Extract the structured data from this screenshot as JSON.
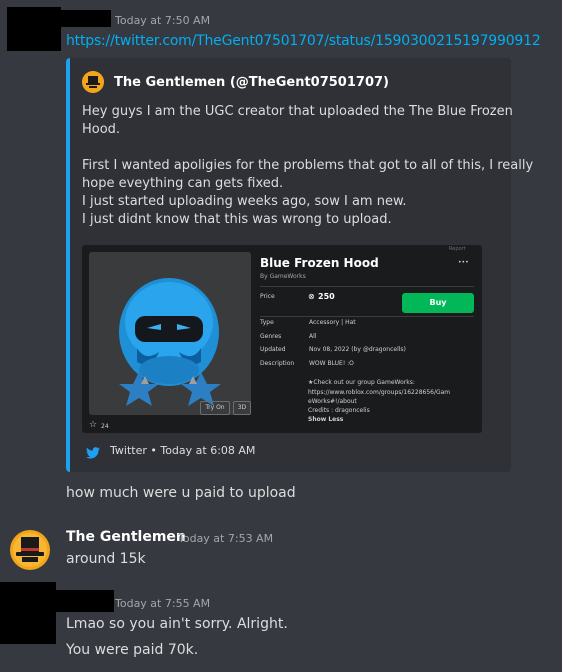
{
  "message1": {
    "timestamp": "Today at 7:50 AM",
    "link": "https://twitter.com/TheGent07501707/status/1590300215197990912"
  },
  "embed": {
    "author": "The Gentlemen (@TheGent07501707)",
    "lines": [
      "Hey guys I am the UGC creator that uploaded the The Blue Frozen",
      "Hood.",
      "",
      "First I wanted apoligies for the problems that got to all of this, I really",
      "hope eveything can gets fixed.",
      "I just started uploading weeks ago, sow I am new.",
      "I just didnt know that this was wrong to upload."
    ],
    "card": {
      "title": "Blue Frozen Hood",
      "by": "By GameWorks",
      "price_label": "Price",
      "price": "250",
      "buy_label": "Buy",
      "type_label": "Type",
      "type_value": "Accessory | Hat",
      "genres_label": "Genres",
      "genres_value": "All",
      "updated_label": "Updated",
      "updated_value": "Nov 08, 2022 (by @dragoncells)",
      "description_label": "Description",
      "description_value": "WOW BLUE! :O",
      "desc_lines": [
        "★Check out our group GameWorks:",
        "https://www.roblox.com/groups/16228656/Gam",
        "eWorks#!/about",
        "Credits : dragoncelis"
      ],
      "show_less": "Show Less",
      "try_on": "Try On",
      "three_d": "3D",
      "favorites": "24",
      "report": "Report",
      "more": "•••"
    },
    "footer": "Twitter • Today at 6:08 AM"
  },
  "message2": {
    "text": "how much were u paid to upload"
  },
  "message3": {
    "username": "The Gentlemen",
    "timestamp": "Today at 7:53 AM",
    "text": "around 15k"
  },
  "message4": {
    "timestamp": "Today at 7:55 AM",
    "lines": [
      "Lmao so you ain't sorry. Alright.",
      "You were paid 70k."
    ]
  },
  "colors": {
    "background": "#36393f",
    "embed_bar": "#1da1f2",
    "link": "#00aff4",
    "buy": "#02b757"
  }
}
